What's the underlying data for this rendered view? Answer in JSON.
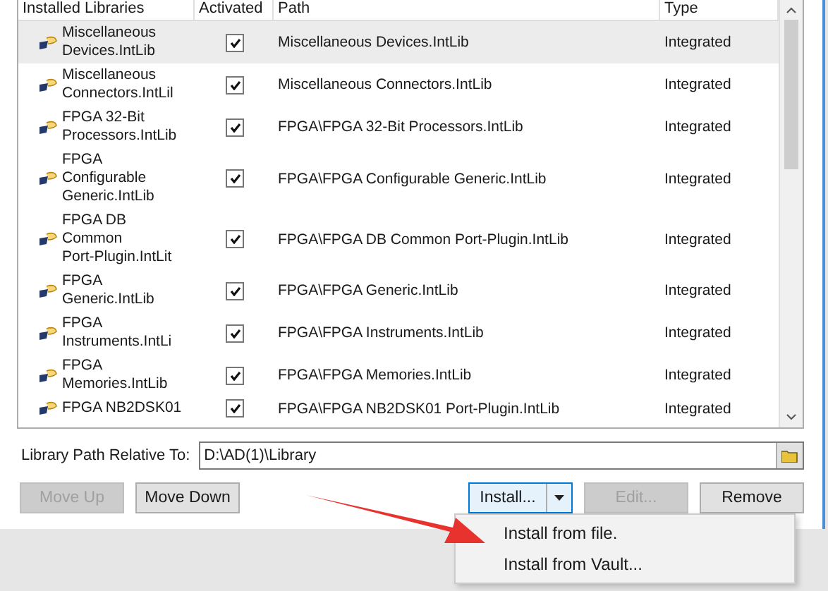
{
  "table": {
    "columns": [
      "Installed Libraries",
      "Activated",
      "Path",
      "Type"
    ],
    "rows": [
      {
        "name_lines": [
          "Miscellaneous",
          "Devices.IntLib"
        ],
        "activated": true,
        "path": "Miscellaneous Devices.IntLib",
        "type": "Integrated",
        "selected": true
      },
      {
        "name_lines": [
          "Miscellaneous",
          "Connectors.IntLil"
        ],
        "activated": true,
        "path": "Miscellaneous Connectors.IntLib",
        "type": "Integrated",
        "selected": false
      },
      {
        "name_lines": [
          "FPGA 32-Bit",
          "Processors.IntLib"
        ],
        "activated": true,
        "path": "FPGA\\FPGA 32-Bit Processors.IntLib",
        "type": "Integrated",
        "selected": false
      },
      {
        "name_lines": [
          "FPGA",
          "Configurable",
          "Generic.IntLib"
        ],
        "activated": true,
        "path": "FPGA\\FPGA Configurable Generic.IntLib",
        "type": "Integrated",
        "selected": false
      },
      {
        "name_lines": [
          "FPGA DB",
          "Common",
          "Port-Plugin.IntLit"
        ],
        "activated": true,
        "path": "FPGA\\FPGA DB Common Port-Plugin.IntLib",
        "type": "Integrated",
        "selected": false
      },
      {
        "name_lines": [
          "FPGA",
          "Generic.IntLib"
        ],
        "activated": true,
        "path": "FPGA\\FPGA Generic.IntLib",
        "type": "Integrated",
        "selected": false
      },
      {
        "name_lines": [
          "FPGA",
          "Instruments.IntLi"
        ],
        "activated": true,
        "path": "FPGA\\FPGA Instruments.IntLib",
        "type": "Integrated",
        "selected": false
      },
      {
        "name_lines": [
          "FPGA",
          "Memories.IntLib"
        ],
        "activated": true,
        "path": "FPGA\\FPGA Memories.IntLib",
        "type": "Integrated",
        "selected": false
      },
      {
        "name_lines": [
          "FPGA NB2DSK01"
        ],
        "activated": true,
        "path": "FPGA\\FPGA NB2DSK01 Port-Plugin.IntLib",
        "type": "Integrated",
        "selected": false
      }
    ]
  },
  "library_path": {
    "label": "Library Path Relative To:",
    "value": "D:\\AD(1)\\Library"
  },
  "buttons": [
    {
      "label": "Move Up",
      "disabled": true
    },
    {
      "label": "Move Down",
      "disabled": false
    },
    {
      "label": "Install...",
      "kind": "split",
      "disabled": false
    },
    {
      "label": "Edit...",
      "disabled": true
    },
    {
      "label": "Remove",
      "disabled": false
    }
  ],
  "install_menu": [
    "Install from file.",
    "Install from Vault..."
  ]
}
